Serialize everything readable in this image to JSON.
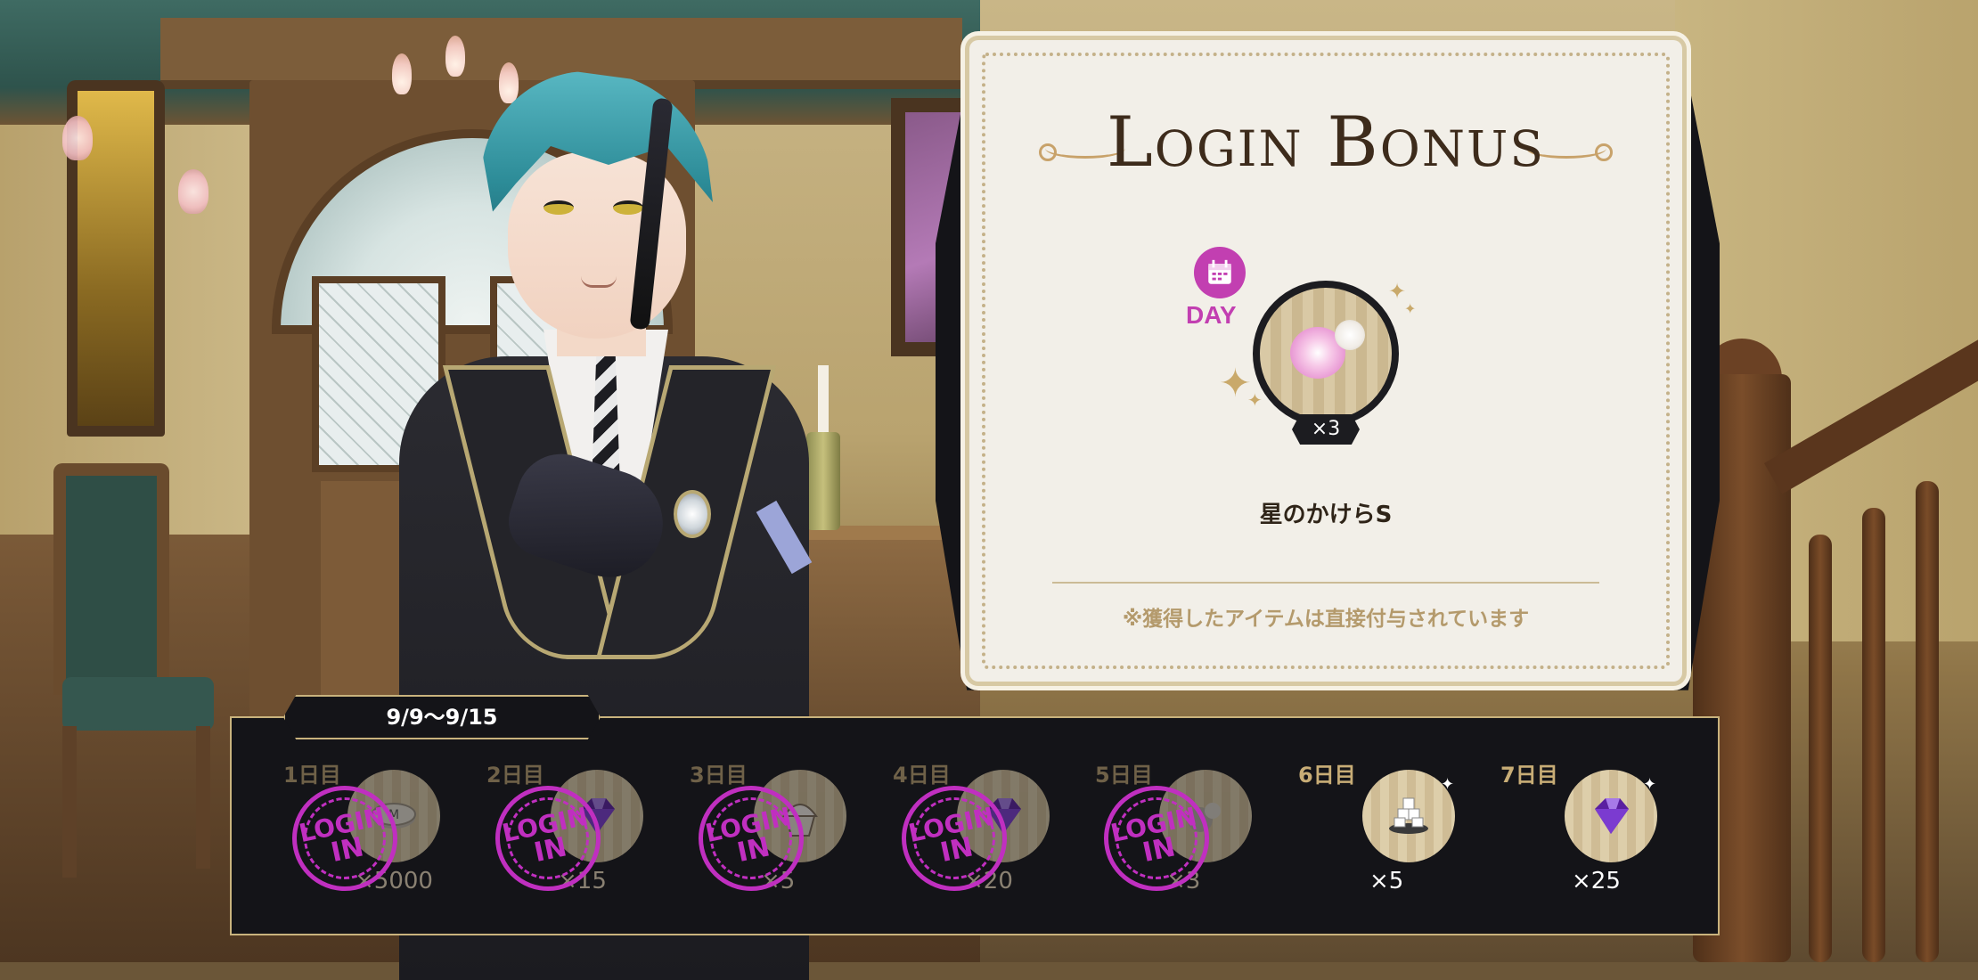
{
  "card": {
    "title": "Login Bonus",
    "day_badge": "DAY",
    "reward_quantity": "×3",
    "reward_name": "星のかけらS",
    "note": "※獲得したアイテムは直接付与されています"
  },
  "week": {
    "date_range": "9/9〜9/15",
    "days": [
      {
        "label": "1日目",
        "count": "×5000",
        "icon": "madol-coin-icon",
        "claimed": true
      },
      {
        "label": "2日目",
        "count": "×15",
        "icon": "purple-gem-icon",
        "claimed": true
      },
      {
        "label": "3日目",
        "count": "×5",
        "icon": "cupcake-icon",
        "claimed": true
      },
      {
        "label": "4日目",
        "count": "×20",
        "icon": "purple-gem-icon",
        "claimed": true
      },
      {
        "label": "5日目",
        "count": "×3",
        "icon": "star-fragment-icon",
        "claimed": true
      },
      {
        "label": "6日目",
        "count": "×5",
        "icon": "sugar-cubes-icon",
        "claimed": false
      },
      {
        "label": "7日目",
        "count": "×25",
        "icon": "purple-gem-icon",
        "claimed": false
      }
    ],
    "stamp": {
      "line1": "LOGIN",
      "line2": "IN"
    }
  },
  "colors": {
    "accent_magenta": "#c23fb1",
    "strip_bg": "#141418",
    "gold_border": "#c9b37d",
    "card_bg": "#f2efe8"
  }
}
